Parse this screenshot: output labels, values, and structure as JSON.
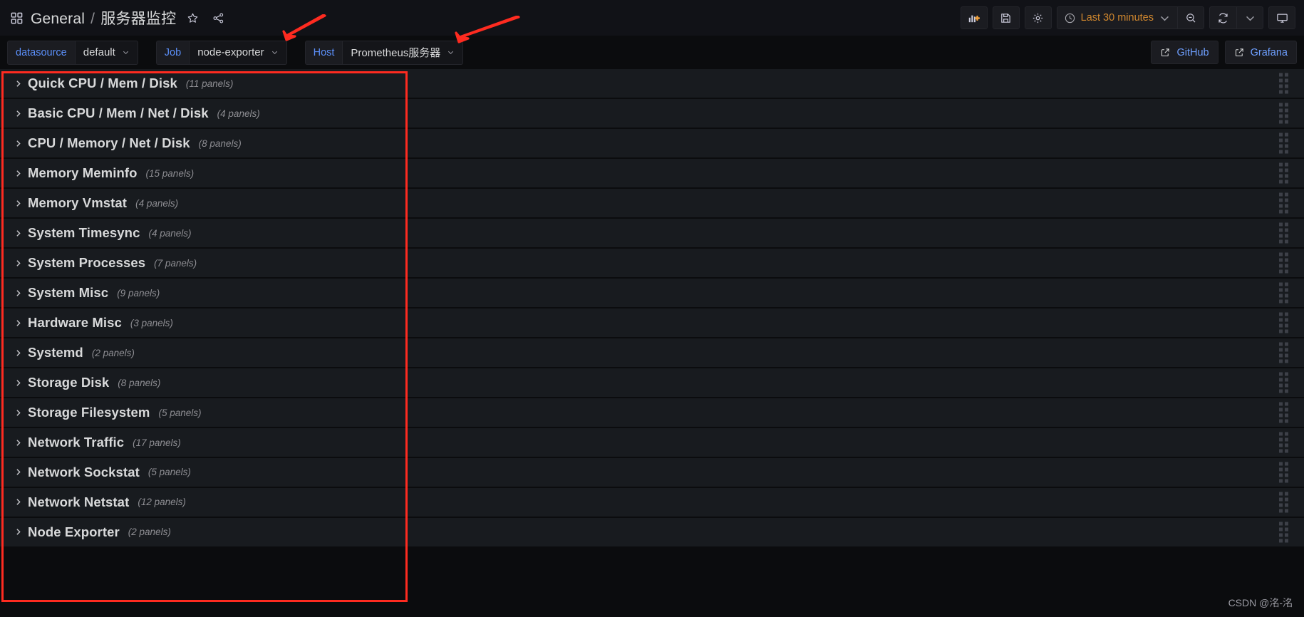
{
  "header": {
    "dashboard_icon": "apps-grid-icon",
    "folder": "General",
    "separator": "/",
    "title": "服务器监控",
    "star_icon": "star-icon",
    "share_icon": "share-nodes-icon",
    "toolbar": {
      "add_panel_label": "add-panel",
      "add_panel_icon": "bar-chart-plus-icon",
      "save_label": "save-dashboard",
      "save_icon": "save-floppy-icon",
      "settings_label": "dashboard-settings",
      "settings_icon": "gear-icon",
      "time_range": "Last 30 minutes",
      "time_icon": "clock-icon",
      "time_chevron": "chevron-down-icon",
      "zoom_out_icon": "zoom-out-icon",
      "refresh_icon": "refresh-icon",
      "refresh_chevron": "chevron-down-icon",
      "kiosk_icon": "tv-monitor-icon"
    }
  },
  "variables": [
    {
      "label": "datasource",
      "value": "default",
      "has_chevron": true
    },
    {
      "label": "Job",
      "value": "node-exporter",
      "has_chevron": true
    },
    {
      "label": "Host",
      "value": "Prometheus服务器",
      "has_chevron": true
    }
  ],
  "links": [
    {
      "label": "GitHub",
      "icon": "external-link-icon"
    },
    {
      "label": "Grafana",
      "icon": "external-link-icon"
    }
  ],
  "rows": [
    {
      "title": "Quick CPU / Mem / Disk",
      "count": "(11 panels)"
    },
    {
      "title": "Basic CPU / Mem / Net / Disk",
      "count": "(4 panels)"
    },
    {
      "title": "CPU / Memory / Net / Disk",
      "count": "(8 panels)"
    },
    {
      "title": "Memory Meminfo",
      "count": "(15 panels)"
    },
    {
      "title": "Memory Vmstat",
      "count": "(4 panels)"
    },
    {
      "title": "System Timesync",
      "count": "(4 panels)"
    },
    {
      "title": "System Processes",
      "count": "(7 panels)"
    },
    {
      "title": "System Misc",
      "count": "(9 panels)"
    },
    {
      "title": "Hardware Misc",
      "count": "(3 panels)"
    },
    {
      "title": "Systemd",
      "count": "(2 panels)"
    },
    {
      "title": "Storage Disk",
      "count": "(8 panels)"
    },
    {
      "title": "Storage Filesystem",
      "count": "(5 panels)"
    },
    {
      "title": "Network Traffic",
      "count": "(17 panels)"
    },
    {
      "title": "Network Sockstat",
      "count": "(5 panels)"
    },
    {
      "title": "Network Netstat",
      "count": "(12 panels)"
    },
    {
      "title": "Node Exporter",
      "count": "(2 panels)"
    }
  ],
  "annotations": {
    "highlight_color": "#fe2b20",
    "arrow_color": "#fe2b20",
    "arrow_count": 2
  },
  "watermark": "CSDN @洺-洺"
}
